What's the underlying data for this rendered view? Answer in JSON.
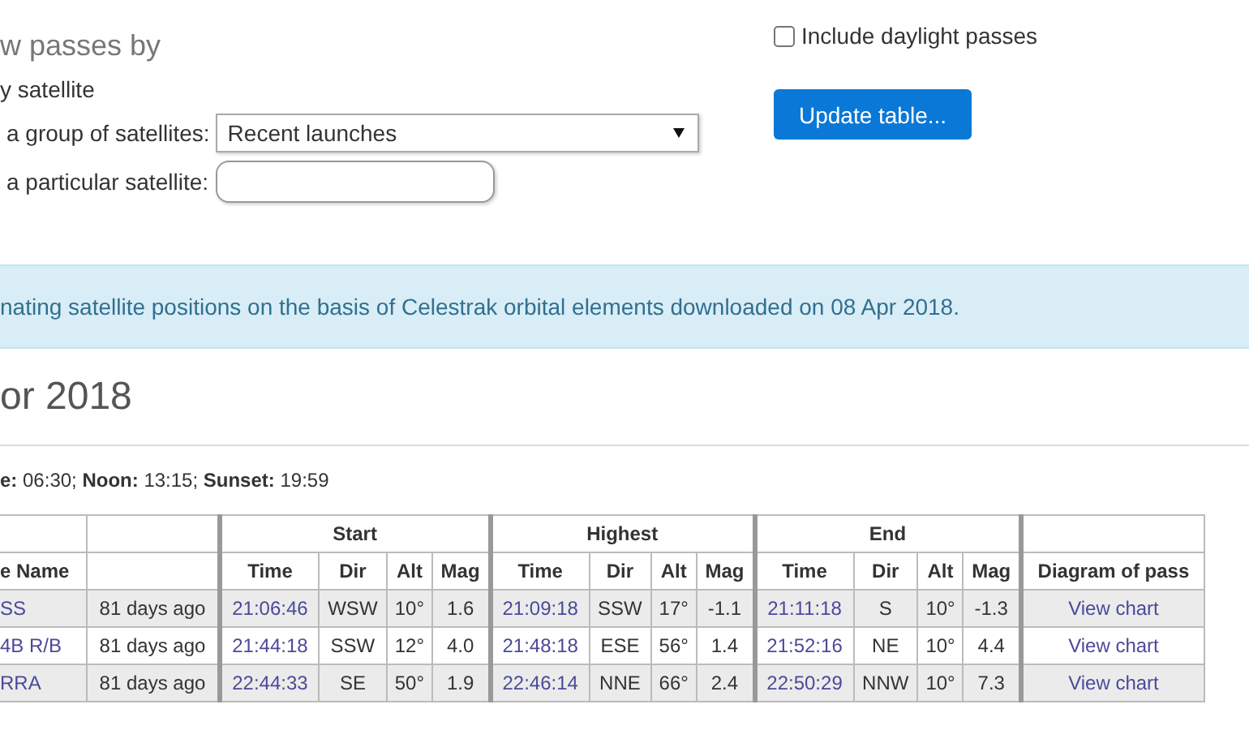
{
  "form": {
    "heading": "w passes by",
    "option_label": "y satellite",
    "group_label": "a group of satellites:",
    "group_value": "Recent launches",
    "particular_label": "a particular satellite:",
    "daylight": {
      "label": "Include daylight passes",
      "checked": false
    },
    "update_button": "Update table..."
  },
  "info_banner": "nating satellite positions on the basis of Celestrak orbital elements downloaded on 08 Apr 2018.",
  "date_heading": "or 2018",
  "sun_times": "**e:** 06:30; **Noon:** 13:15; **Sunset:** 19:59",
  "table": {
    "groups": [
      {
        "label": "Start",
        "sub_headers": [
          "Time",
          "Dir",
          "Alt",
          "Mag"
        ]
      },
      {
        "label": "Highest",
        "sub_headers": [
          "Time",
          "Dir",
          "Alt",
          "Mag"
        ]
      },
      {
        "label": "End",
        "sub_headers": [
          "Time",
          "Dir",
          "Alt",
          "Mag"
        ]
      }
    ],
    "name_header": "e Name",
    "diagram_header": "Diagram of pass",
    "rows": [
      {
        "name": "SS",
        "age": "81 days ago",
        "start": [
          "21:06:46",
          "WSW",
          "10°",
          "1.6"
        ],
        "highest": [
          "21:09:18",
          "SSW",
          "17°",
          "-1.1"
        ],
        "end": [
          "21:11:18",
          "S",
          "10°",
          "-1.3"
        ],
        "diagram": "View chart"
      },
      {
        "name": "4B R/B",
        "age": "81 days ago",
        "start": [
          "21:44:18",
          "SSW",
          "12°",
          "4.0"
        ],
        "highest": [
          "21:48:18",
          "ESE",
          "56°",
          "1.4"
        ],
        "end": [
          "21:52:16",
          "NE",
          "10°",
          "4.4"
        ],
        "diagram": "View chart"
      },
      {
        "name": "RRA",
        "age": "81 days ago",
        "start": [
          "22:44:33",
          "SE",
          "50°",
          "1.9"
        ],
        "highest": [
          "22:46:14",
          "NNE",
          "66°",
          "2.4"
        ],
        "end": [
          "22:50:29",
          "NNW",
          "10°",
          "7.3"
        ],
        "diagram": "View chart"
      }
    ]
  }
}
